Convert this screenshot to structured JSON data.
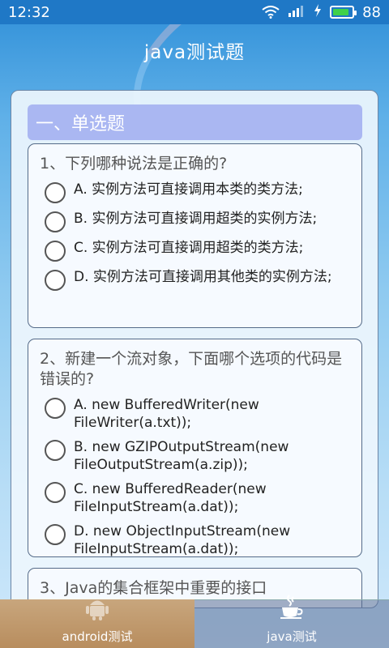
{
  "status_bar": {
    "time": "12:32",
    "battery_level": "88",
    "battery_fraction": 0.88
  },
  "title": "java测试题",
  "section": {
    "header": "一、单选题"
  },
  "questions": [
    {
      "text": "1、下列哪种说法是正确的?",
      "options": [
        "A. 实例方法可直接调用本类的类方法;",
        "B. 实例方法可直接调用超类的实例方法;",
        "C. 实例方法可直接调用超类的类方法;",
        "D. 实例方法可直接调用其他类的实例方法;"
      ]
    },
    {
      "text": "2、新建一个流对象，下面哪个选项的代码是错误的?",
      "options": [
        "A. new BufferedWriter(new FileWriter(a.txt));",
        "B. new GZIPOutputStream(new FileOutputStream(a.zip));",
        "C. new BufferedReader(new FileInputStream(a.dat));",
        "D. new ObjectInputStream(new FileInputStream(a.dat));"
      ]
    },
    {
      "text": "3、Java的集合框架中重要的接口"
    }
  ],
  "tabs": [
    {
      "label": "android测试",
      "icon": "android-icon"
    },
    {
      "label": "java测试",
      "icon": "coffee-cup-icon"
    }
  ],
  "colors": {
    "status_bar": "#1f78c6",
    "section_header": "#aab7f2",
    "battery": "#3fd14a",
    "tab_android": "#c8a67d"
  }
}
